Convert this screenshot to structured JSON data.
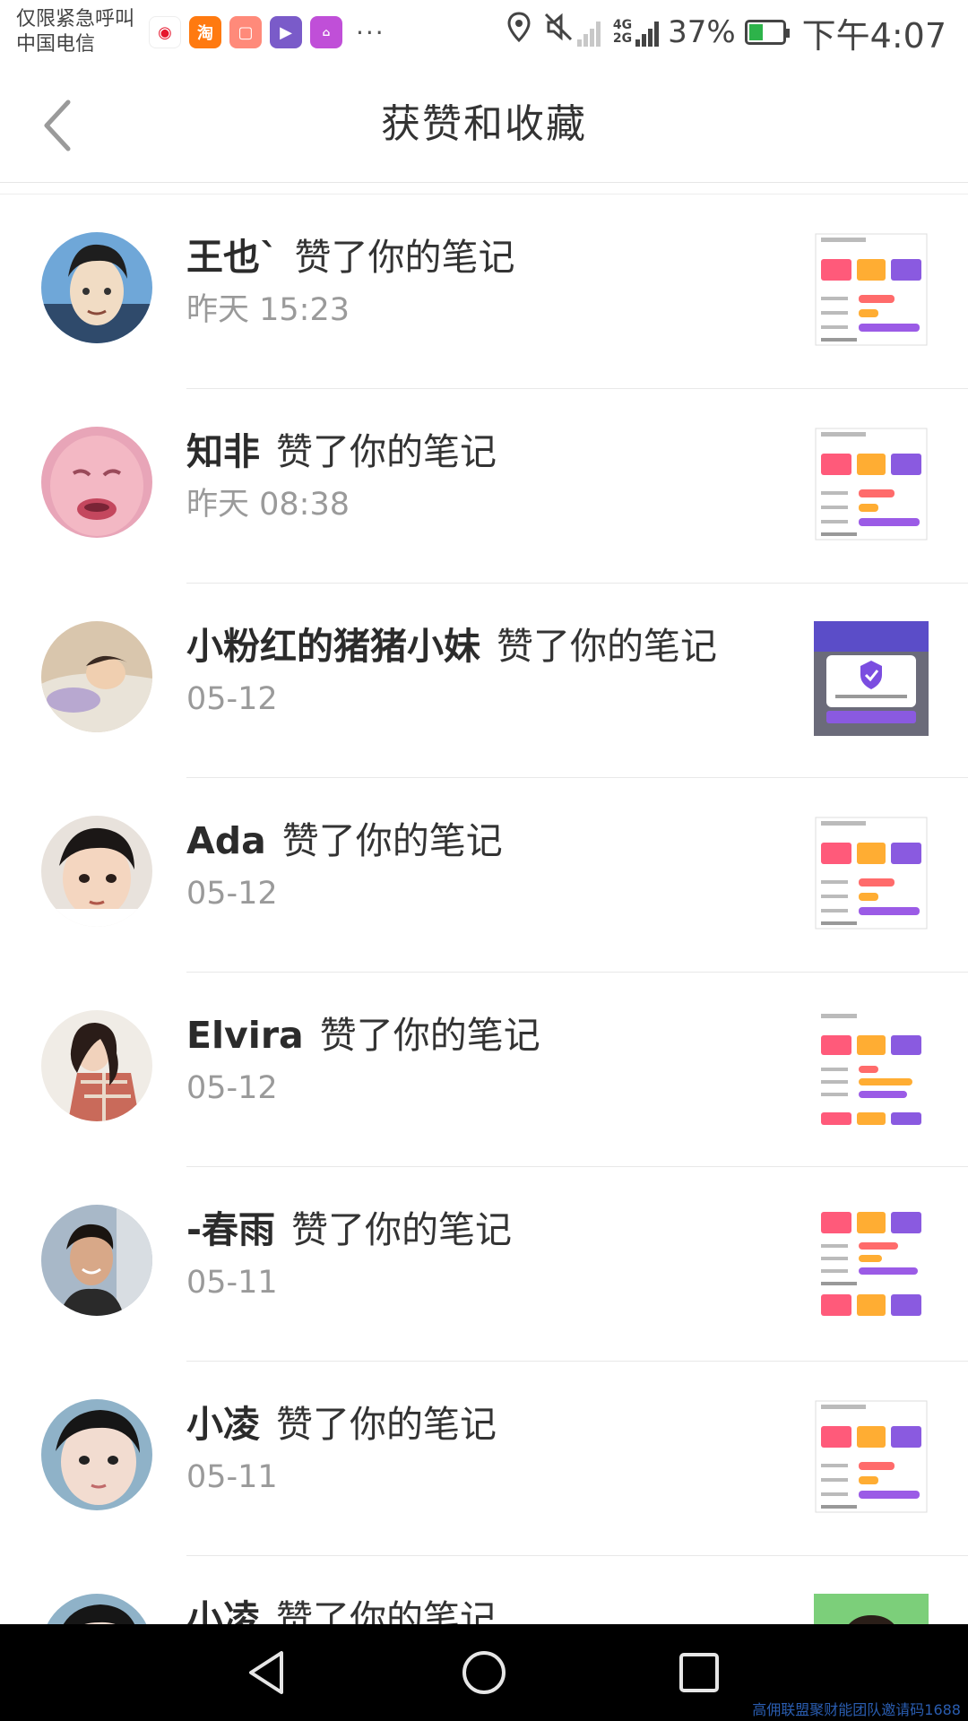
{
  "status_bar": {
    "carrier_line1": "仅限紧急呼叫",
    "carrier_line2": "中国电信",
    "notification_icons": [
      "weibo-icon",
      "taobao-icon",
      "box-icon",
      "video-icon",
      "app-icon"
    ],
    "more": "···",
    "network": "4G",
    "network2": "2G",
    "battery_percent": "37%",
    "battery_level": 0.37,
    "time": "下午4:07"
  },
  "header": {
    "title": "获赞和收藏",
    "back_icon": "chevron-left-icon"
  },
  "notifications": [
    {
      "user": "王也`",
      "action": "赞了你的笔记",
      "time": "昨天 15:23",
      "avatar": "anime-portrait",
      "thumb": "stats-card"
    },
    {
      "user": "知非",
      "action": "赞了你的笔记",
      "time": "昨天 08:38",
      "avatar": "crying-face",
      "thumb": "stats-card"
    },
    {
      "user": "小粉红的猪猪小妹",
      "action": "赞了你的笔记",
      "time": "05-12",
      "avatar": "sleeping-child",
      "thumb": "purple-dialog"
    },
    {
      "user": "Ada",
      "action": "赞了你的笔记",
      "time": "05-12",
      "avatar": "girl-selfie",
      "thumb": "stats-card"
    },
    {
      "user": "Elvira",
      "action": "赞了你的笔记",
      "time": "05-12",
      "avatar": "woman-plaid",
      "thumb": "stats-card"
    },
    {
      "user": "-春雨",
      "action": "赞了你的笔记",
      "time": "05-11",
      "avatar": "man-portrait",
      "thumb": "stats-card"
    },
    {
      "user": "小凌",
      "action": "赞了你的笔记",
      "time": "05-11",
      "avatar": "girl-closeup",
      "thumb": "stats-card"
    },
    {
      "user": "小凌",
      "action": "赞了你的笔记",
      "time": "",
      "avatar": "girl-closeup",
      "thumb": "photo"
    }
  ],
  "nav_bar": {
    "back": "nav-back-icon",
    "home": "nav-home-icon",
    "recent": "nav-recents-icon",
    "watermark": "高佣联盟聚财能团队邀请码1688"
  },
  "colors": {
    "divider": "#e8e8e8",
    "time_gray": "#9a9a9a",
    "nav_background": "#000000",
    "accent_purple": "#7b4de0"
  }
}
